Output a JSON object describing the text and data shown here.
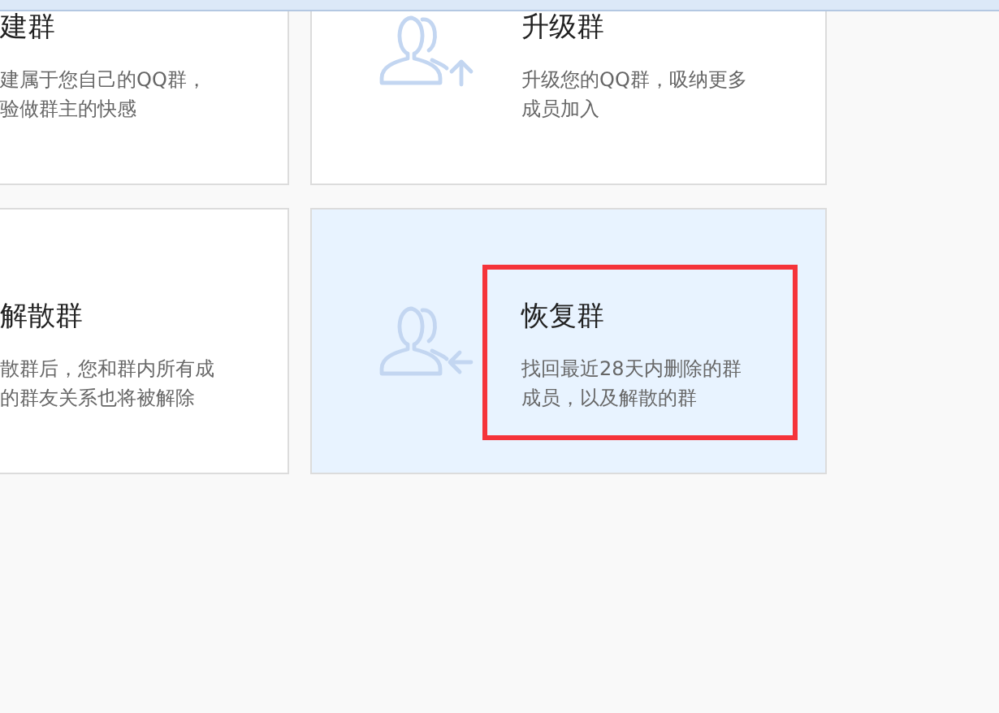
{
  "cards": [
    {
      "kind": "plain",
      "title": "建群",
      "description_lines": [
        "建属于您自己的QQ群，",
        "验做群主的快感"
      ],
      "selected": false,
      "highlighted": false
    },
    {
      "kind": "upgrade",
      "title": "升级群",
      "description_lines": [
        "升级您的QQ群，吸纳更多",
        "成员加入"
      ],
      "selected": false,
      "highlighted": false
    },
    {
      "kind": "plain",
      "title": "解散群",
      "description_lines": [
        "散群后，您和群内所有成",
        "的群友关系也将被解除"
      ],
      "selected": false,
      "highlighted": false
    },
    {
      "kind": "restore",
      "title": "恢复群",
      "description_lines": [
        "找回最近28天内删除的群",
        "成员，以及解散的群"
      ],
      "selected": true,
      "highlighted": true
    }
  ]
}
